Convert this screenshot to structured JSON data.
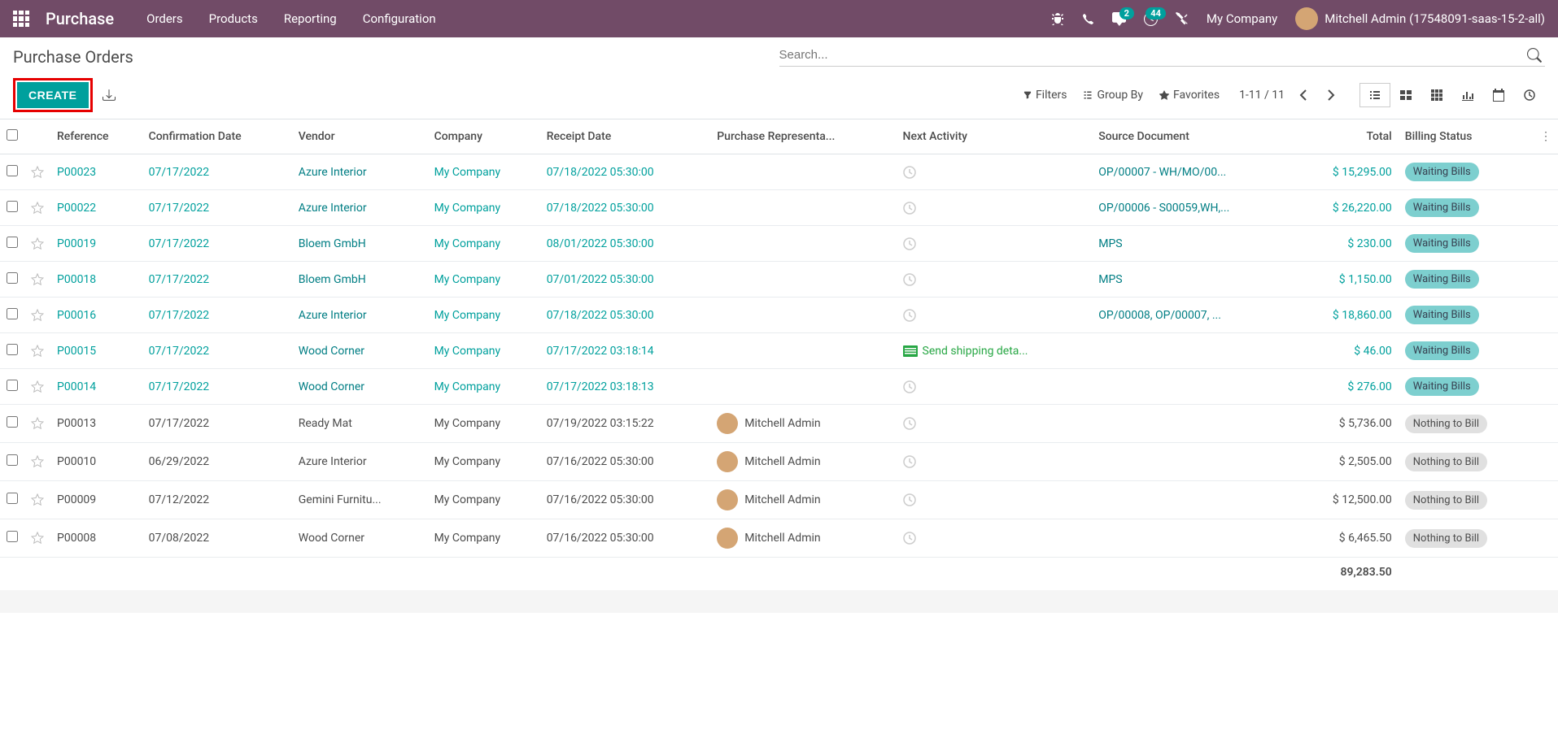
{
  "navbar": {
    "brand": "Purchase",
    "menu": [
      "Orders",
      "Products",
      "Reporting",
      "Configuration"
    ],
    "messaging_badge": "2",
    "activities_badge": "44",
    "company": "My Company",
    "user": "Mitchell Admin (17548091-saas-15-2-all)"
  },
  "breadcrumb": "Purchase Orders",
  "search": {
    "placeholder": "Search..."
  },
  "buttons": {
    "create": "CREATE"
  },
  "search_options": {
    "filters": "Filters",
    "groupby": "Group By",
    "favorites": "Favorites"
  },
  "pager": {
    "range": "1-11 / 11"
  },
  "columns": {
    "reference": "Reference",
    "confirmation_date": "Confirmation Date",
    "vendor": "Vendor",
    "company": "Company",
    "receipt_date": "Receipt Date",
    "purchase_rep": "Purchase Representa...",
    "next_activity": "Next Activity",
    "source_doc": "Source Document",
    "total": "Total",
    "billing_status": "Billing Status"
  },
  "rows": [
    {
      "ref": "P00023",
      "conf": "07/17/2022",
      "vendor": "Azure Interior",
      "company": "My Company",
      "receipt": "07/18/2022 05:30:00",
      "rep": "",
      "activity": "",
      "source": "OP/00007 - WH/MO/00...",
      "total": "$ 15,295.00",
      "status": "Waiting Bills",
      "linked": true
    },
    {
      "ref": "P00022",
      "conf": "07/17/2022",
      "vendor": "Azure Interior",
      "company": "My Company",
      "receipt": "07/18/2022 05:30:00",
      "rep": "",
      "activity": "",
      "source": "OP/00006 - S00059,WH,...",
      "total": "$ 26,220.00",
      "status": "Waiting Bills",
      "linked": true
    },
    {
      "ref": "P00019",
      "conf": "07/17/2022",
      "vendor": "Bloem GmbH",
      "company": "My Company",
      "receipt": "08/01/2022 05:30:00",
      "rep": "",
      "activity": "",
      "source": "MPS",
      "total": "$ 230.00",
      "status": "Waiting Bills",
      "linked": true
    },
    {
      "ref": "P00018",
      "conf": "07/17/2022",
      "vendor": "Bloem GmbH",
      "company": "My Company",
      "receipt": "07/01/2022 05:30:00",
      "rep": "",
      "activity": "",
      "source": "MPS",
      "total": "$ 1,150.00",
      "status": "Waiting Bills",
      "linked": true
    },
    {
      "ref": "P00016",
      "conf": "07/17/2022",
      "vendor": "Azure Interior",
      "company": "My Company",
      "receipt": "07/18/2022 05:30:00",
      "rep": "",
      "activity": "",
      "source": "OP/00008, OP/00007, ...",
      "total": "$ 18,860.00",
      "status": "Waiting Bills",
      "linked": true
    },
    {
      "ref": "P00015",
      "conf": "07/17/2022",
      "vendor": "Wood Corner",
      "company": "My Company",
      "receipt": "07/17/2022 03:18:14",
      "rep": "",
      "activity": "Send shipping deta...",
      "activity_green": true,
      "source": "",
      "total": "$ 46.00",
      "status": "Waiting Bills",
      "linked": true
    },
    {
      "ref": "P00014",
      "conf": "07/17/2022",
      "vendor": "Wood Corner",
      "company": "My Company",
      "receipt": "07/17/2022 03:18:13",
      "rep": "",
      "activity": "",
      "source": "",
      "total": "$ 276.00",
      "status": "Waiting Bills",
      "linked": true
    },
    {
      "ref": "P00013",
      "conf": "07/17/2022",
      "vendor": "Ready Mat",
      "company": "My Company",
      "receipt": "07/19/2022 03:15:22",
      "rep": "Mitchell Admin",
      "activity": "",
      "source": "",
      "total": "$ 5,736.00",
      "status": "Nothing to Bill",
      "linked": false
    },
    {
      "ref": "P00010",
      "conf": "06/29/2022",
      "vendor": "Azure Interior",
      "company": "My Company",
      "receipt": "07/16/2022 05:30:00",
      "rep": "Mitchell Admin",
      "activity": "",
      "source": "",
      "total": "$ 2,505.00",
      "status": "Nothing to Bill",
      "linked": false
    },
    {
      "ref": "P00009",
      "conf": "07/12/2022",
      "vendor": "Gemini Furnitu...",
      "company": "My Company",
      "receipt": "07/16/2022 05:30:00",
      "rep": "Mitchell Admin",
      "activity": "",
      "source": "",
      "total": "$ 12,500.00",
      "status": "Nothing to Bill",
      "linked": false
    },
    {
      "ref": "P00008",
      "conf": "07/08/2022",
      "vendor": "Wood Corner",
      "company": "My Company",
      "receipt": "07/16/2022 05:30:00",
      "rep": "Mitchell Admin",
      "activity": "",
      "source": "",
      "total": "$ 6,465.50",
      "status": "Nothing to Bill",
      "linked": false
    }
  ],
  "footer": {
    "total": "89,283.50"
  }
}
